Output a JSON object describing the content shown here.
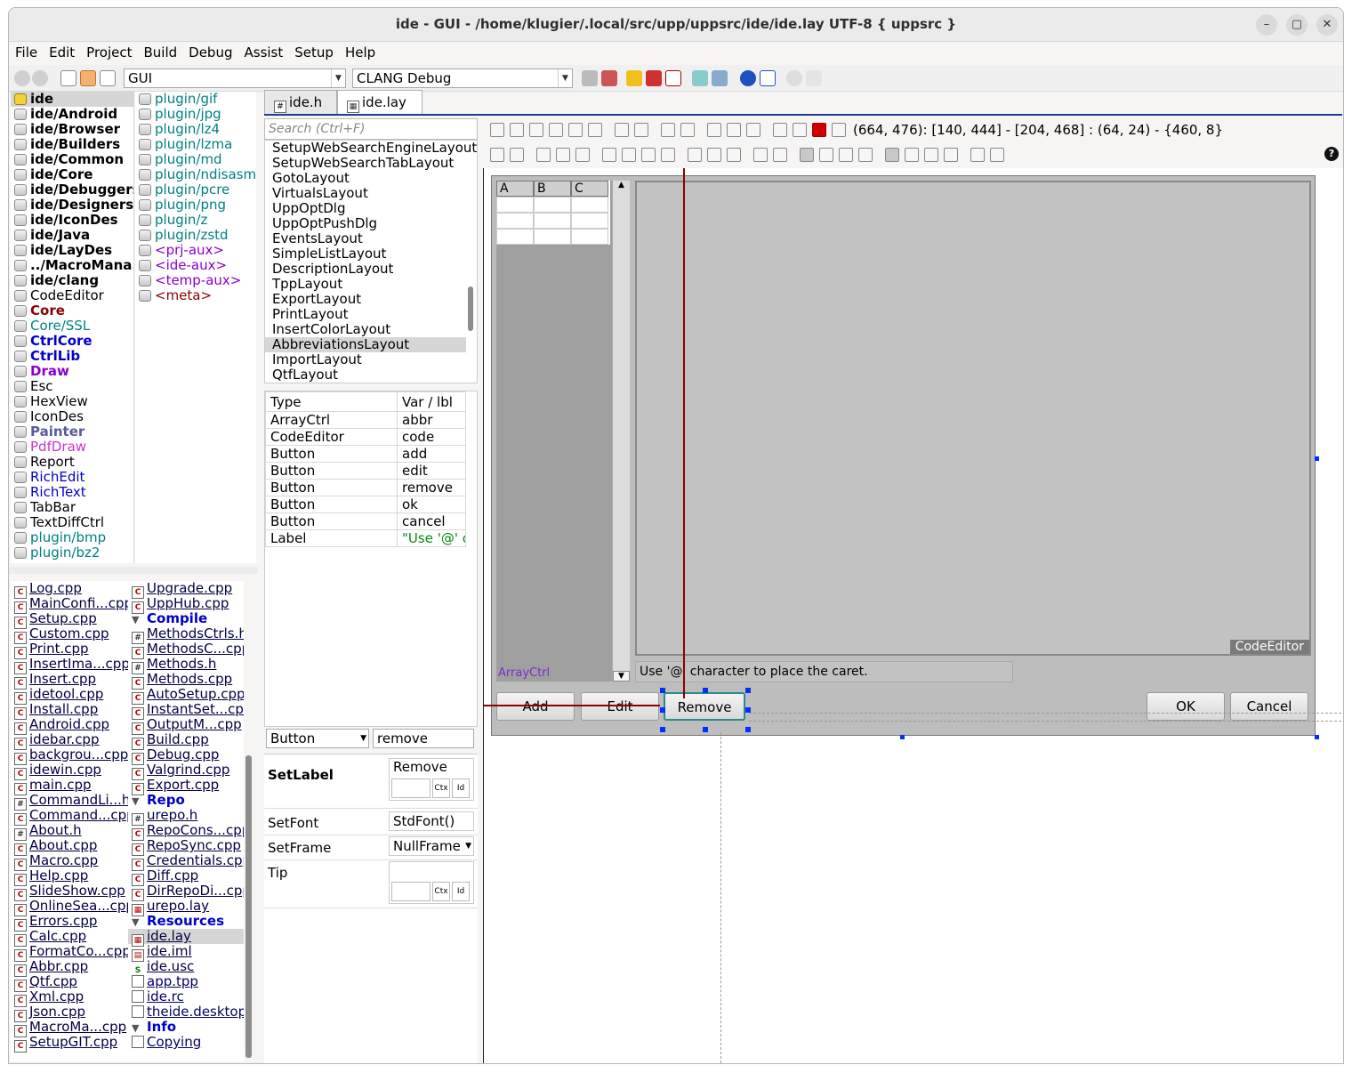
{
  "window": {
    "title": "ide - GUI - /home/klugier/.local/src/upp/uppsrc/ide/ide.lay UTF-8 { uppsrc }"
  },
  "menu": [
    "File",
    "Edit",
    "Project",
    "Build",
    "Debug",
    "Assist",
    "Setup",
    "Help"
  ],
  "toolbar": {
    "package_combo": "GUI",
    "build_combo": "CLANG Debug"
  },
  "packages_left": [
    {
      "label": "ide",
      "bold": true,
      "color": "#000000",
      "selected": true
    },
    {
      "label": "ide/Android",
      "bold": true,
      "color": "#000000"
    },
    {
      "label": "ide/Browser",
      "bold": true,
      "color": "#000000"
    },
    {
      "label": "ide/Builders",
      "bold": true,
      "color": "#000000"
    },
    {
      "label": "ide/Common",
      "bold": true,
      "color": "#000000"
    },
    {
      "label": "ide/Core",
      "bold": true,
      "color": "#000000"
    },
    {
      "label": "ide/Debuggers",
      "bold": true,
      "color": "#000000"
    },
    {
      "label": "ide/Designers",
      "bold": true,
      "color": "#000000"
    },
    {
      "label": "ide/IconDes",
      "bold": true,
      "color": "#000000"
    },
    {
      "label": "ide/Java",
      "bold": true,
      "color": "#000000"
    },
    {
      "label": "ide/LayDes",
      "bold": true,
      "color": "#000000"
    },
    {
      "label": "../MacroMana...",
      "bold": true,
      "color": "#000000"
    },
    {
      "label": "ide/clang",
      "bold": true,
      "color": "#000000"
    },
    {
      "label": "CodeEditor",
      "bold": false,
      "color": "#000000"
    },
    {
      "label": "Core",
      "bold": true,
      "color": "#8b0000"
    },
    {
      "label": "Core/SSL",
      "bold": false,
      "color": "#008080"
    },
    {
      "label": "CtrlCore",
      "bold": true,
      "color": "#0000cc"
    },
    {
      "label": "CtrlLib",
      "bold": true,
      "color": "#0000cc"
    },
    {
      "label": "Draw",
      "bold": true,
      "color": "#8b00cc"
    },
    {
      "label": "Esc",
      "bold": false,
      "color": "#000000"
    },
    {
      "label": "HexView",
      "bold": false,
      "color": "#000000"
    },
    {
      "label": "IconDes",
      "bold": false,
      "color": "#000000"
    },
    {
      "label": "Painter",
      "bold": true,
      "color": "#5a5aa0"
    },
    {
      "label": "PdfDraw",
      "bold": false,
      "color": "#cc33cc"
    },
    {
      "label": "Report",
      "bold": false,
      "color": "#000000"
    },
    {
      "label": "RichEdit",
      "bold": false,
      "color": "#0000cc"
    },
    {
      "label": "RichText",
      "bold": false,
      "color": "#0000cc"
    },
    {
      "label": "TabBar",
      "bold": false,
      "color": "#000000"
    },
    {
      "label": "TextDiffCtrl",
      "bold": false,
      "color": "#000000"
    },
    {
      "label": "plugin/bmp",
      "bold": false,
      "color": "#008080"
    },
    {
      "label": "plugin/bz2",
      "bold": false,
      "color": "#008080"
    }
  ],
  "packages_right": [
    {
      "label": "plugin/gif",
      "color": "#008080"
    },
    {
      "label": "plugin/jpg",
      "color": "#008080"
    },
    {
      "label": "plugin/lz4",
      "color": "#008080"
    },
    {
      "label": "plugin/lzma",
      "color": "#008080"
    },
    {
      "label": "plugin/md",
      "color": "#008080"
    },
    {
      "label": "plugin/ndisasm",
      "color": "#008080"
    },
    {
      "label": "plugin/pcre",
      "color": "#008080"
    },
    {
      "label": "plugin/png",
      "color": "#008080"
    },
    {
      "label": "plugin/z",
      "color": "#008080"
    },
    {
      "label": "plugin/zstd",
      "color": "#008080"
    },
    {
      "label": "<prj-aux>",
      "color": "#8b00cc"
    },
    {
      "label": "<ide-aux>",
      "color": "#8b00cc"
    },
    {
      "label": "<temp-aux>",
      "color": "#8b00cc"
    },
    {
      "label": "<meta>",
      "color": "#8b0000"
    }
  ],
  "files_left": [
    {
      "label": "Log.cpp",
      "type": "cpp"
    },
    {
      "label": "MainConfi...cpp",
      "type": "cpp"
    },
    {
      "label": "Setup.cpp",
      "type": "cpp"
    },
    {
      "label": "Custom.cpp",
      "type": "cpp"
    },
    {
      "label": "Print.cpp",
      "type": "cpp"
    },
    {
      "label": "InsertIma...cpp",
      "type": "cpp"
    },
    {
      "label": "Insert.cpp",
      "type": "cpp"
    },
    {
      "label": "idetool.cpp",
      "type": "cpp"
    },
    {
      "label": "Install.cpp",
      "type": "cpp"
    },
    {
      "label": "Android.cpp",
      "type": "cpp"
    },
    {
      "label": "idebar.cpp",
      "type": "cpp"
    },
    {
      "label": "backgrou...cpp",
      "type": "cpp"
    },
    {
      "label": "idewin.cpp",
      "type": "cpp"
    },
    {
      "label": "main.cpp",
      "type": "cpp"
    },
    {
      "label": "CommandLi...h",
      "type": "h"
    },
    {
      "label": "Command...cpp",
      "type": "cpp"
    },
    {
      "label": "About.h",
      "type": "h"
    },
    {
      "label": "About.cpp",
      "type": "cpp"
    },
    {
      "label": "Macro.cpp",
      "type": "cpp"
    },
    {
      "label": "Help.cpp",
      "type": "cpp"
    },
    {
      "label": "SlideShow.cpp",
      "type": "cpp"
    },
    {
      "label": "OnlineSea...cpp",
      "type": "cpp"
    },
    {
      "label": "Errors.cpp",
      "type": "cpp"
    },
    {
      "label": "Calc.cpp",
      "type": "cpp"
    },
    {
      "label": "FormatCo...cpp",
      "type": "cpp"
    },
    {
      "label": "Abbr.cpp",
      "type": "cpp"
    },
    {
      "label": "Qtf.cpp",
      "type": "cpp"
    },
    {
      "label": "Xml.cpp",
      "type": "cpp"
    },
    {
      "label": "Json.cpp",
      "type": "cpp"
    },
    {
      "label": "MacroMa...cpp",
      "type": "cpp"
    },
    {
      "label": "SetupGIT.cpp",
      "type": "cpp"
    }
  ],
  "files_right": [
    {
      "label": "Upgrade.cpp",
      "type": "cpp"
    },
    {
      "label": "UppHub.cpp",
      "type": "cpp"
    },
    {
      "label": "Compile",
      "type": "group"
    },
    {
      "label": "MethodsCtrls.h",
      "type": "h"
    },
    {
      "label": "MethodsC...cpp",
      "type": "cpp"
    },
    {
      "label": "Methods.h",
      "type": "h"
    },
    {
      "label": "Methods.cpp",
      "type": "cpp"
    },
    {
      "label": "AutoSetup.cpp",
      "type": "cpp"
    },
    {
      "label": "InstantSet...cpp",
      "type": "cpp"
    },
    {
      "label": "OutputM...cpp",
      "type": "cpp"
    },
    {
      "label": "Build.cpp",
      "type": "cpp"
    },
    {
      "label": "Debug.cpp",
      "type": "cpp"
    },
    {
      "label": "Valgrind.cpp",
      "type": "cpp"
    },
    {
      "label": "Export.cpp",
      "type": "cpp"
    },
    {
      "label": "Repo",
      "type": "group"
    },
    {
      "label": "urepo.h",
      "type": "h"
    },
    {
      "label": "RepoCons...cpp",
      "type": "cpp"
    },
    {
      "label": "RepoSync.cpp",
      "type": "cpp"
    },
    {
      "label": "Credentials.cpp",
      "type": "cpp"
    },
    {
      "label": "Diff.cpp",
      "type": "cpp"
    },
    {
      "label": "DirRepoDi...cpp",
      "type": "cpp"
    },
    {
      "label": "urepo.lay",
      "type": "lay"
    },
    {
      "label": "Resources",
      "type": "group"
    },
    {
      "label": "ide.lay",
      "type": "lay",
      "selected": true
    },
    {
      "label": "ide.iml",
      "type": "iml"
    },
    {
      "label": "ide.usc",
      "type": "usc"
    },
    {
      "label": "app.tpp",
      "type": "tpp"
    },
    {
      "label": "ide.rc",
      "type": "rc"
    },
    {
      "label": "theide.desktop",
      "type": "rc"
    },
    {
      "label": "Info",
      "type": "group"
    },
    {
      "label": "Copying",
      "type": "rc"
    }
  ],
  "editor_tabs": [
    {
      "label": "ide.h",
      "icon": "#",
      "close": "×"
    },
    {
      "label": "ide.lay",
      "icon": "▦",
      "close": "×",
      "active": true
    }
  ],
  "layout_search_placeholder": "Search (Ctrl+F)",
  "layouts": [
    "SetupWebSearchEngineLayout",
    "SetupWebSearchTabLayout",
    "GotoLayout",
    "VirtualsLayout",
    "UppOptDlg",
    "UppOptPushDlg",
    "EventsLayout",
    "SimpleListLayout",
    "DescriptionLayout",
    "TppLayout",
    "ExportLayout",
    "PrintLayout",
    "InsertColorLayout",
    "AbbreviationsLayout",
    "ImportLayout",
    "QtfLayout"
  ],
  "selected_layout": "AbbreviationsLayout",
  "items_table": {
    "headers": [
      "Type",
      "Var / lbl"
    ],
    "rows": [
      [
        "ArrayCtrl",
        "abbr"
      ],
      [
        "CodeEditor",
        "code"
      ],
      [
        "Button",
        "add"
      ],
      [
        "Button",
        "edit"
      ],
      [
        "Button",
        "remove"
      ],
      [
        "Button",
        "ok"
      ],
      [
        "Button",
        "cancel"
      ],
      [
        "Label",
        "\"Use '@' ch"
      ]
    ]
  },
  "properties": {
    "type_value": "Button",
    "var_value": "remove",
    "setlabel_name": "SetLabel",
    "setlabel_value": "Remove",
    "ctx": "Ctx",
    "id": "Id",
    "setfont_name": "SetFont",
    "setfont_value": "StdFont()",
    "setframe_name": "SetFrame",
    "setframe_value": "NullFrame",
    "tip_name": "Tip"
  },
  "coords_readout": "(664, 476): [140, 444] - [204, 468] : (64, 24) - {460, 8}",
  "canvas": {
    "array_cols": [
      "A",
      "B",
      "C"
    ],
    "arrayctrl_label": "ArrayCtrl",
    "codeeditor_label": "CodeEditor",
    "caret_label": "Use '@' character to place the caret.",
    "btn_add": "Add",
    "btn_edit": "Edit",
    "btn_remove": "Remove",
    "btn_ok": "OK",
    "btn_cancel": "Cancel"
  },
  "help_icon_glyph": "?"
}
